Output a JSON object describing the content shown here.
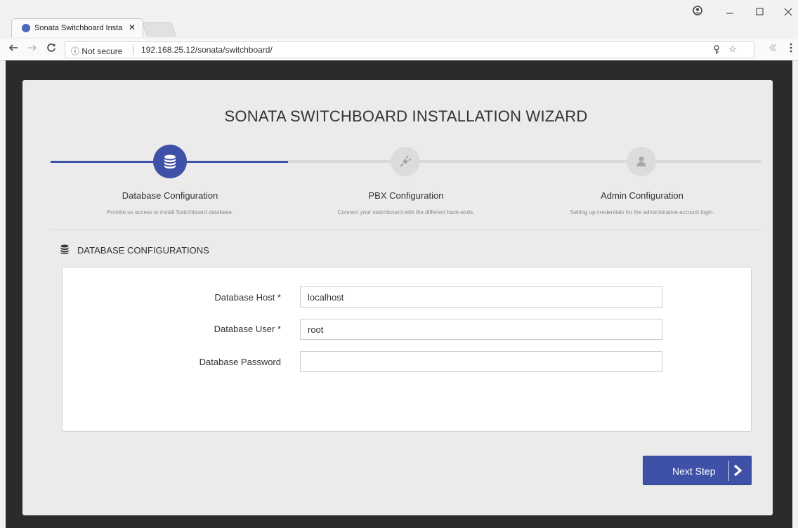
{
  "browser": {
    "tab_title": "Sonata Switchboard Insta",
    "tab_close": "✕",
    "security": "ⓘ Not secure",
    "url": "192.168.25.12/sonata/switchboard/"
  },
  "wizard": {
    "title": "SONATA SWITCHBOARD INSTALLATION WIZARD",
    "steps": [
      {
        "label": "Database Configuration",
        "description": "Provide us access to install Switchboard database.",
        "icon": "database-icon",
        "active": true
      },
      {
        "label": "PBX Configuration",
        "description": "Connect your switchboard with the different back-ends.",
        "icon": "plug-icon",
        "active": false
      },
      {
        "label": "Admin Configuration",
        "description": "Setting up credentials for the administrative account login.",
        "icon": "user-icon",
        "active": false
      }
    ],
    "section_title": "DATABASE CONFIGURATIONS",
    "fields": [
      {
        "label": "Database Host *",
        "value": "localhost"
      },
      {
        "label": "Database User *",
        "value": "root"
      },
      {
        "label": "Database Password",
        "value": ""
      }
    ],
    "next_button": "Next Step"
  },
  "colors": {
    "accent": "#3f51a7",
    "inactive_step": "#dcdcdc",
    "background_card": "#ebebeb"
  }
}
